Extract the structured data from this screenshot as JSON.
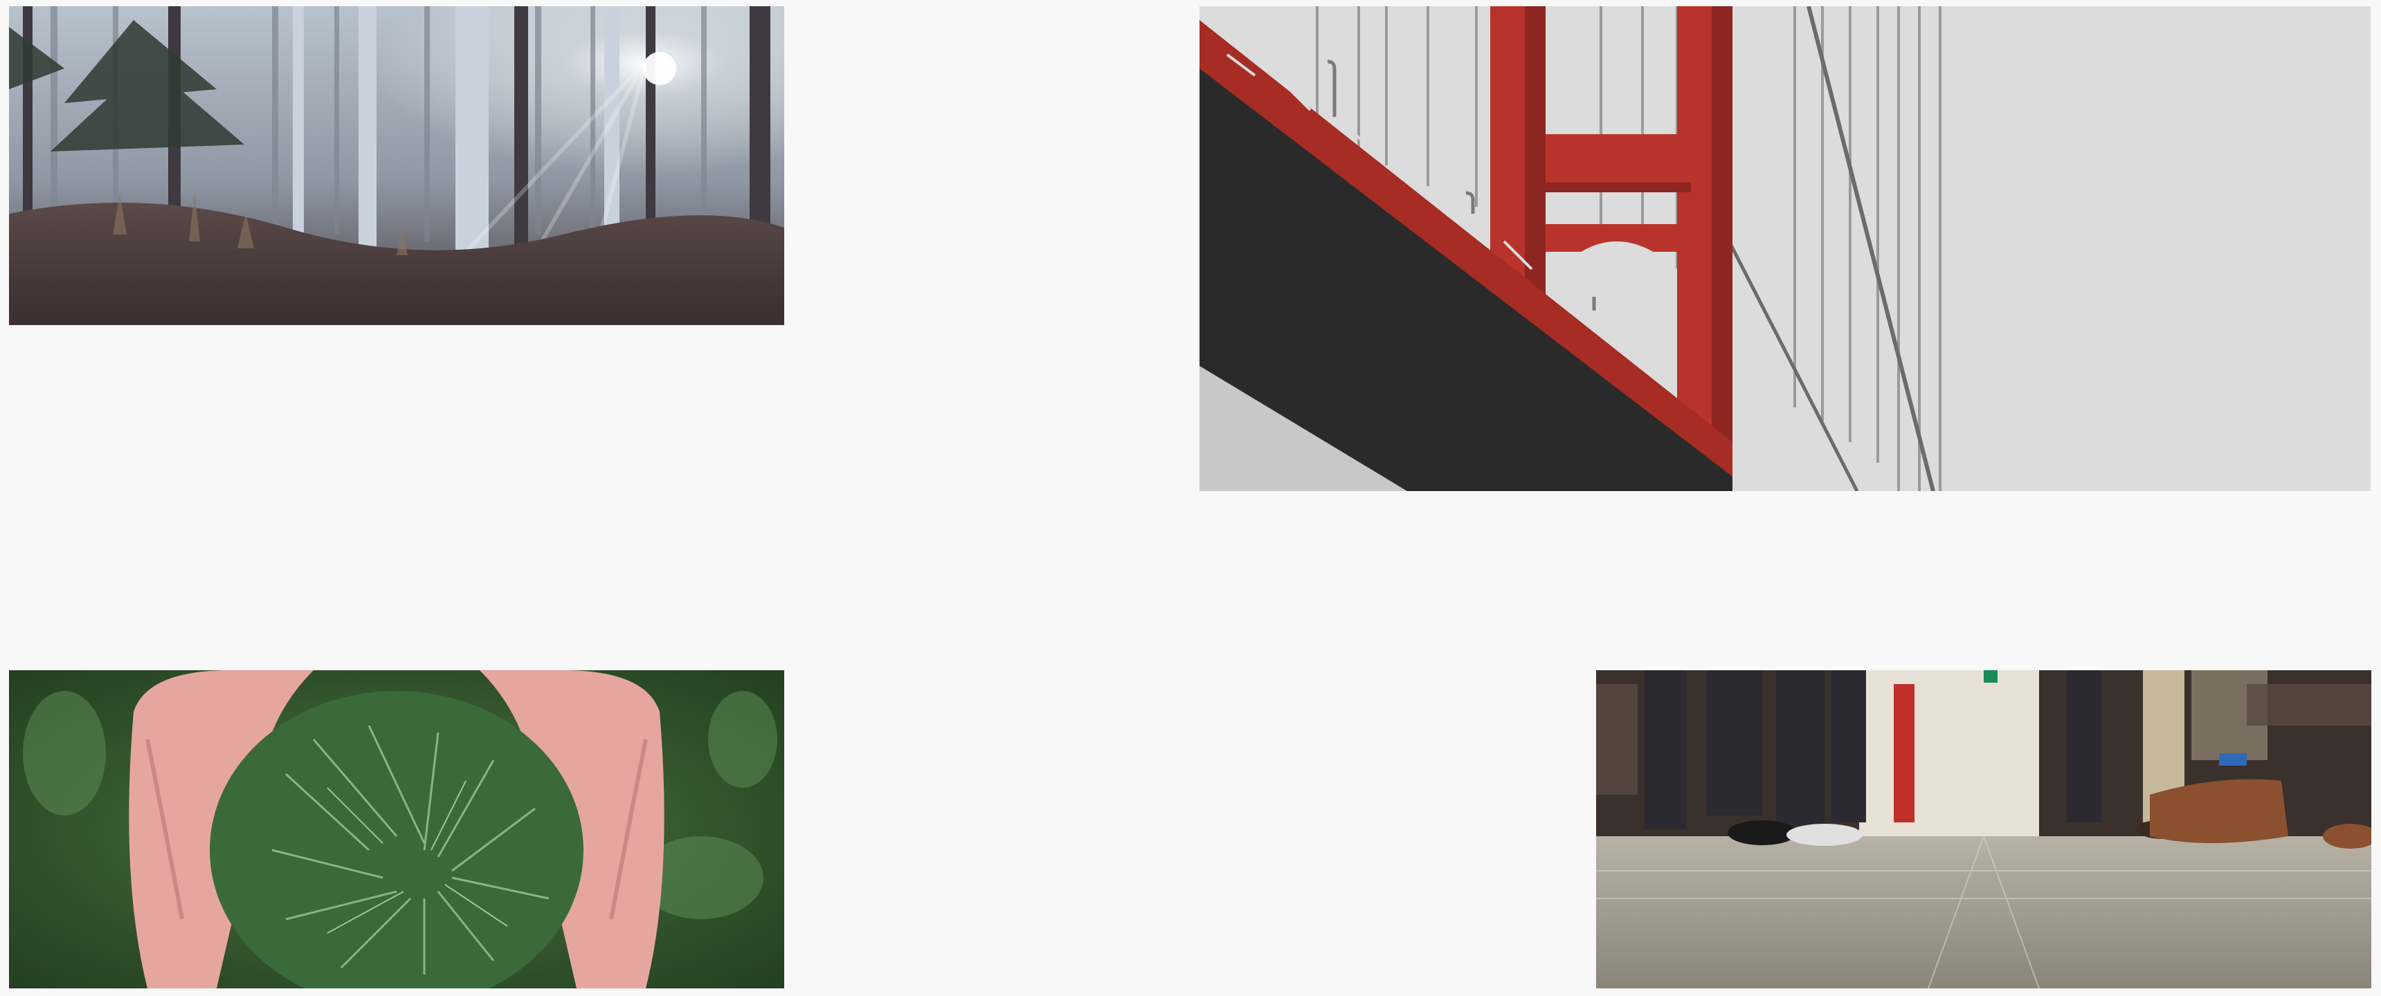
{
  "gallery": {
    "background": "#f8f8f8",
    "tiles": [
      {
        "subject": "misty-forest-photo"
      },
      {
        "subject": "red-suspension-bridge-photo"
      },
      {
        "subject": "hands-holding-pine-needles-photo"
      },
      {
        "subject": "commuter-feet-on-train-floor-photo"
      }
    ]
  },
  "colors": {
    "forest_fog": "#9aa3ad",
    "bridge_red": "#b8332b",
    "sky_gray": "#dcdcdc",
    "pine_green": "#4f7a45",
    "skin": "#e6a6a0",
    "floor": "#9c958a"
  }
}
